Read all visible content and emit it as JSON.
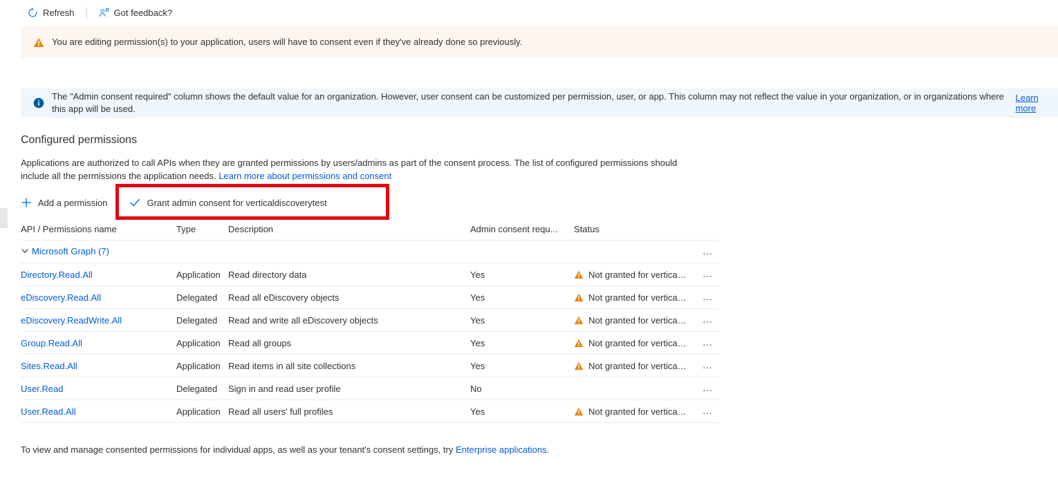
{
  "commandbar": {
    "refresh_label": "Refresh",
    "feedback_label": "Got feedback?",
    "refresh_icon": "refresh-icon",
    "feedback_icon": "feedback-person-icon"
  },
  "banners": {
    "warning": {
      "icon": "warning-triangle-icon",
      "text": "You are editing permission(s) to your application, users will have to consent even if they've already done so previously.",
      "background": "#fdf6f0"
    },
    "info": {
      "icon": "info-circle-icon",
      "text": "The \"Admin consent required\" column shows the default value for an organization. However, user consent can be customized per permission, user, or app. This column may not reflect the value in your organization, or in organizations where this app will be used.",
      "link_label": "Learn more",
      "background": "#eff6fc"
    }
  },
  "section": {
    "title": "Configured permissions",
    "description": "Applications are authorized to call APIs when they are granted permissions by users/admins as part of the consent process. The list of configured permissions should include all the permissions the application needs.",
    "description_link": "Learn more about permissions and consent"
  },
  "actions": {
    "add_permission_label": "Add a permission",
    "add_permission_icon": "plus-icon",
    "grant_consent_label": "Grant admin consent for verticaldiscoverytest",
    "grant_consent_icon": "checkmark-icon",
    "highlight_color": "#e30613"
  },
  "table": {
    "headers": {
      "name": "API / Permissions name",
      "type": "Type",
      "description": "Description",
      "admin_consent": "Admin consent requ...",
      "status": "Status"
    },
    "group": {
      "label": "Microsoft Graph (7)",
      "chevron_icon": "chevron-down-icon",
      "menu_icon": "ellipsis-icon"
    },
    "rows": [
      {
        "name": "Directory.Read.All",
        "type": "Application",
        "description": "Read directory data",
        "admin_consent": "Yes",
        "status": "Not granted for vertical...",
        "status_icon": "warning-triangle-icon",
        "menu_icon": "ellipsis-icon"
      },
      {
        "name": "eDiscovery.Read.All",
        "type": "Delegated",
        "description": "Read all eDiscovery objects",
        "admin_consent": "Yes",
        "status": "Not granted for vertical...",
        "status_icon": "warning-triangle-icon",
        "menu_icon": "ellipsis-icon"
      },
      {
        "name": "eDiscovery.ReadWrite.All",
        "type": "Delegated",
        "description": "Read and write all eDiscovery objects",
        "admin_consent": "Yes",
        "status": "Not granted for vertical...",
        "status_icon": "warning-triangle-icon",
        "menu_icon": "ellipsis-icon"
      },
      {
        "name": "Group.Read.All",
        "type": "Application",
        "description": "Read all groups",
        "admin_consent": "Yes",
        "status": "Not granted for vertical...",
        "status_icon": "warning-triangle-icon",
        "menu_icon": "ellipsis-icon"
      },
      {
        "name": "Sites.Read.All",
        "type": "Application",
        "description": "Read items in all site collections",
        "admin_consent": "Yes",
        "status": "Not granted for vertical...",
        "status_icon": "warning-triangle-icon",
        "menu_icon": "ellipsis-icon"
      },
      {
        "name": "User.Read",
        "type": "Delegated",
        "description": "Sign in and read user profile",
        "admin_consent": "No",
        "status": "",
        "status_icon": "",
        "menu_icon": "ellipsis-icon"
      },
      {
        "name": "User.Read.All",
        "type": "Application",
        "description": "Read all users' full profiles",
        "admin_consent": "Yes",
        "status": "Not granted for vertical...",
        "status_icon": "warning-triangle-icon",
        "menu_icon": "ellipsis-icon"
      }
    ]
  },
  "footer": {
    "text": "To view and manage consented permissions for individual apps, as well as your tenant's consent settings, try",
    "link_label": "Enterprise applications",
    "suffix": "."
  }
}
